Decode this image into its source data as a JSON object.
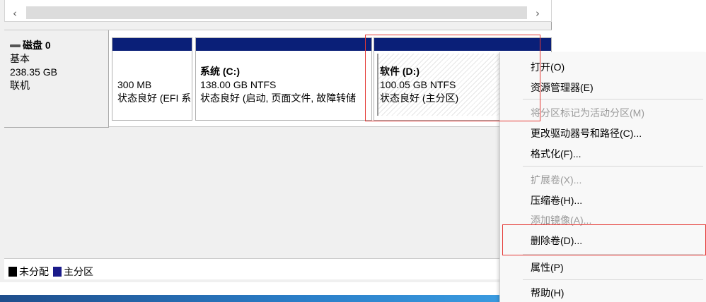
{
  "scrollbar": {
    "left_arrow": "‹",
    "right_arrow": "›"
  },
  "disk": {
    "name": "磁盘 0",
    "type": "基本",
    "size": "238.35 GB",
    "status": "联机"
  },
  "partitions": [
    {
      "name": "",
      "size": "300 MB",
      "status": "状态良好 (EFI 系"
    },
    {
      "name": "系统 (C:)",
      "size": "138.00 GB NTFS",
      "status": "状态良好 (启动, 页面文件, 故障转储"
    },
    {
      "name": "软件 (D:)",
      "size": "100.05 GB NTFS",
      "status": "状态良好 (主分区)"
    }
  ],
  "legend": {
    "unallocated": "未分配",
    "primary": "主分区"
  },
  "colors": {
    "partition_bar": "#0a1f78",
    "highlight": "#e53935",
    "primary_swatch": "#1a1a8a"
  },
  "menu": {
    "items": [
      {
        "label": "打开(O)",
        "enabled": true
      },
      {
        "label": "资源管理器(E)",
        "enabled": true
      },
      {
        "label": "将分区标记为活动分区(M)",
        "enabled": false
      },
      {
        "label": "更改驱动器号和路径(C)...",
        "enabled": true
      },
      {
        "label": "格式化(F)...",
        "enabled": true
      },
      {
        "label": "扩展卷(X)...",
        "enabled": false
      },
      {
        "label": "压缩卷(H)...",
        "enabled": true
      },
      {
        "label": "添加镜像(A)...",
        "enabled": false
      },
      {
        "label": "删除卷(D)...",
        "enabled": true
      },
      {
        "label": "属性(P)",
        "enabled": true
      },
      {
        "label": "帮助(H)",
        "enabled": true
      }
    ]
  }
}
